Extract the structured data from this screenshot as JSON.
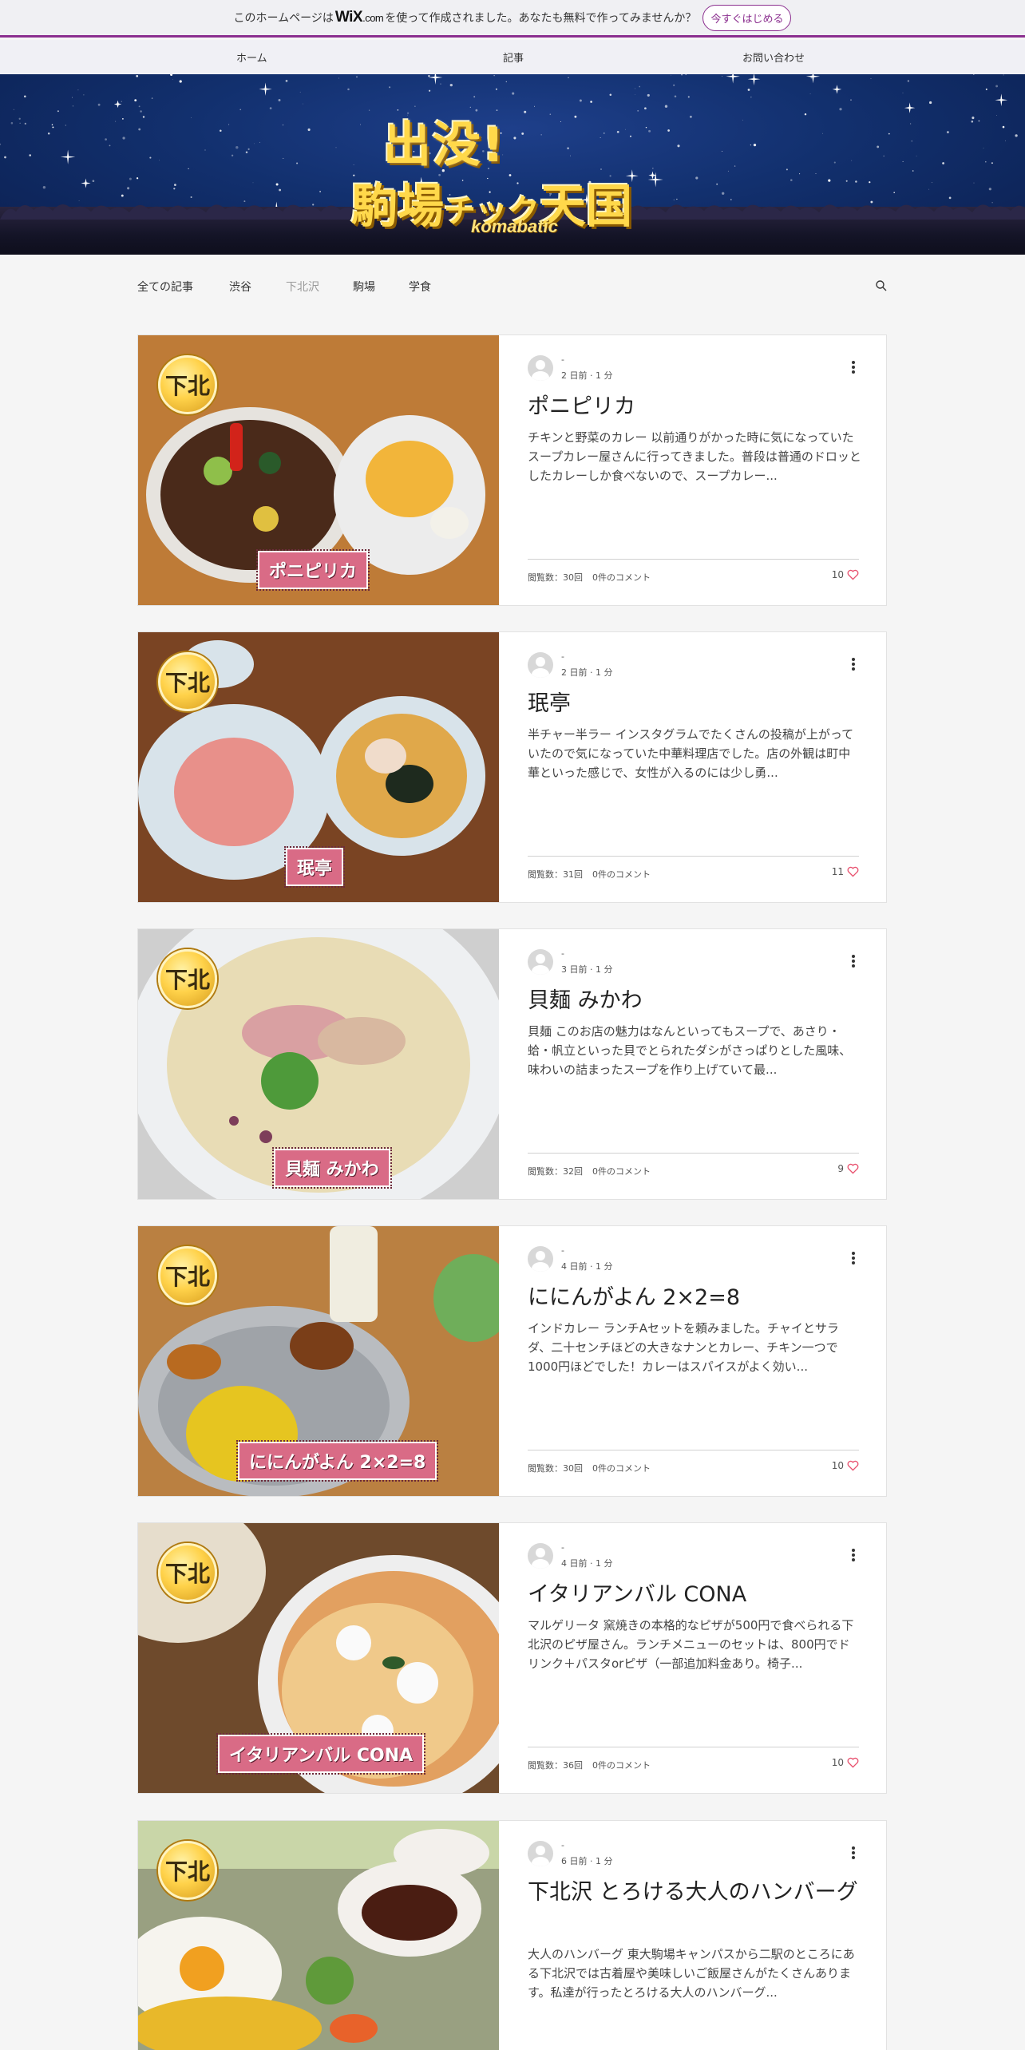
{
  "wix_banner": {
    "text_before": "このホームページは",
    "logo": "WiX",
    "logo_suffix": ".com",
    "text_after": "を使って作成されました。あなたも無料で作ってみませんか？",
    "cta": "今すぐはじめる"
  },
  "top_nav": {
    "items": [
      "ホーム",
      "記事",
      "お問い合わせ"
    ]
  },
  "hero": {
    "line1": "出没!",
    "line2a": "駒場",
    "line2b": "チック",
    "line2c": "天国",
    "line3": "komabatic"
  },
  "categories": [
    "全ての記事",
    "渋谷",
    "下北沢",
    "駒場",
    "学食"
  ],
  "active_category": "下北沢",
  "posts": [
    {
      "badge": "下北",
      "image_label": "ポニピリカ",
      "author": "-",
      "date": "2 日前",
      "read_time": "1 分",
      "title": "ポニピリカ",
      "excerpt": "チキンと野菜のカレー 以前通りがかった時に気になっていたスープカレー屋さんに行ってきました。普段は普通のドロッとしたカレーしか食べないので、スープカレー...",
      "views": "閲覧数：30回",
      "comments": "0件のコメント",
      "likes": "10"
    },
    {
      "badge": "下北",
      "image_label": "珉亭",
      "author": "-",
      "date": "2 日前",
      "read_time": "1 分",
      "title": "珉亭",
      "excerpt": "半チャー半ラー インスタグラムでたくさんの投稿が上がっていたので気になっていた中華料理店でした。店の外観は町中華といった感じで、女性が入るのには少し勇...",
      "views": "閲覧数：31回",
      "comments": "0件のコメント",
      "likes": "11"
    },
    {
      "badge": "下北",
      "image_label": "貝麺 みかわ",
      "author": "-",
      "date": "3 日前",
      "read_time": "1 分",
      "title": "貝麺 みかわ",
      "excerpt": "貝麺 このお店の魅力はなんといってもスープで、あさり・蛤・帆立といった貝でとられたダシがさっぱりとした風味、味わいの詰まったスープを作り上げていて最...",
      "views": "閲覧数：32回",
      "comments": "0件のコメント",
      "likes": "9"
    },
    {
      "badge": "下北",
      "image_label": "ににんがよん 2×2=8",
      "author": "-",
      "date": "4 日前",
      "read_time": "1 分",
      "title": "ににんがよん 2×2=8",
      "excerpt": "インドカレー ランチAセットを頼みました。チャイとサラダ、二十センチほどの大きなナンとカレー、チキン一つで1000円ほどでした！カレーはスパイスがよく効い...",
      "views": "閲覧数：30回",
      "comments": "0件のコメント",
      "likes": "10"
    },
    {
      "badge": "下北",
      "image_label": "イタリアンバル CONA",
      "author": "-",
      "date": "4 日前",
      "read_time": "1 分",
      "title": "イタリアンバル CONA",
      "excerpt": "マルゲリータ 窯焼きの本格的なピザが500円で食べられる下北沢のピザ屋さん。ランチメニューのセットは、800円でドリンク＋パスタorピザ（一部追加料金あり。椅子...",
      "views": "閲覧数：36回",
      "comments": "0件のコメント",
      "likes": "10"
    },
    {
      "badge": "下北",
      "image_label": "",
      "author": "-",
      "date": "6 日前",
      "read_time": "1 分",
      "title": "下北沢 とろける大人のハンバーグ",
      "excerpt": "大人のハンバーグ 東大駒場キャンパスから二駅のところにある下北沢では古着屋や美味しいご飯屋さんがたくさんあります。私達が行ったとろける大人のハンバーグ...",
      "views": "",
      "comments": "",
      "likes": ""
    }
  ],
  "colors": {
    "accent": "#8b2f8f",
    "heart": "#e84f6d",
    "hero_bg": "#12306e",
    "label_pink": "#d96b86"
  }
}
